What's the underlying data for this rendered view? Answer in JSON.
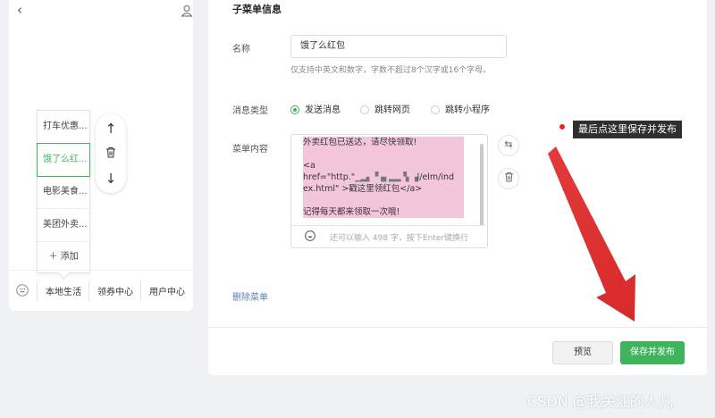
{
  "phone": {
    "back_icon": "chevron-left-icon",
    "profile_icon": "person-icon",
    "submenu_items": [
      "打车优惠...",
      "饿了么红...",
      "电影美食...",
      "美团外卖..."
    ],
    "add_label": "添加",
    "main_menu": [
      "本地生活",
      "领券中心",
      "用户中心"
    ]
  },
  "panel": {
    "title": "子菜单信息",
    "name_label": "名称",
    "name_value": "饿了么红包",
    "name_hint": "仅支持中英文和数字，字数不超过8个汉字或16个字母。",
    "type_label": "消息类型",
    "types": [
      "发送消息",
      "跳转网页",
      "跳转小程序"
    ],
    "selected_type": "发送消息",
    "content_label": "菜单内容",
    "content_lines": {
      "l1": "外卖红包已送达，请尽快领取!",
      "l2": "<a href=\"http.\"",
      "l2_blur": "▁▂▖▝▗▖▂▂▝▖▗",
      "l2_end": "ḷ/elm/ind",
      "l3": "ex.html\" >戳这里领红包</a>",
      "l4": "记得每天都来领取一次哦!"
    },
    "remaining_hint": "还可以输入 498 字，按下Enter键换行",
    "delete_link": "删除菜单",
    "preview_btn": "预览",
    "save_btn": "保存并发布"
  },
  "annotation": {
    "tip": "最后点这里保存并发布",
    "arrow_color": "#e23a3a"
  },
  "watermark": "CSDN @我关注的人儿",
  "colors": {
    "accent": "#3fb45d",
    "link": "#5a7fb0",
    "highlight": "#f4c6dc"
  }
}
